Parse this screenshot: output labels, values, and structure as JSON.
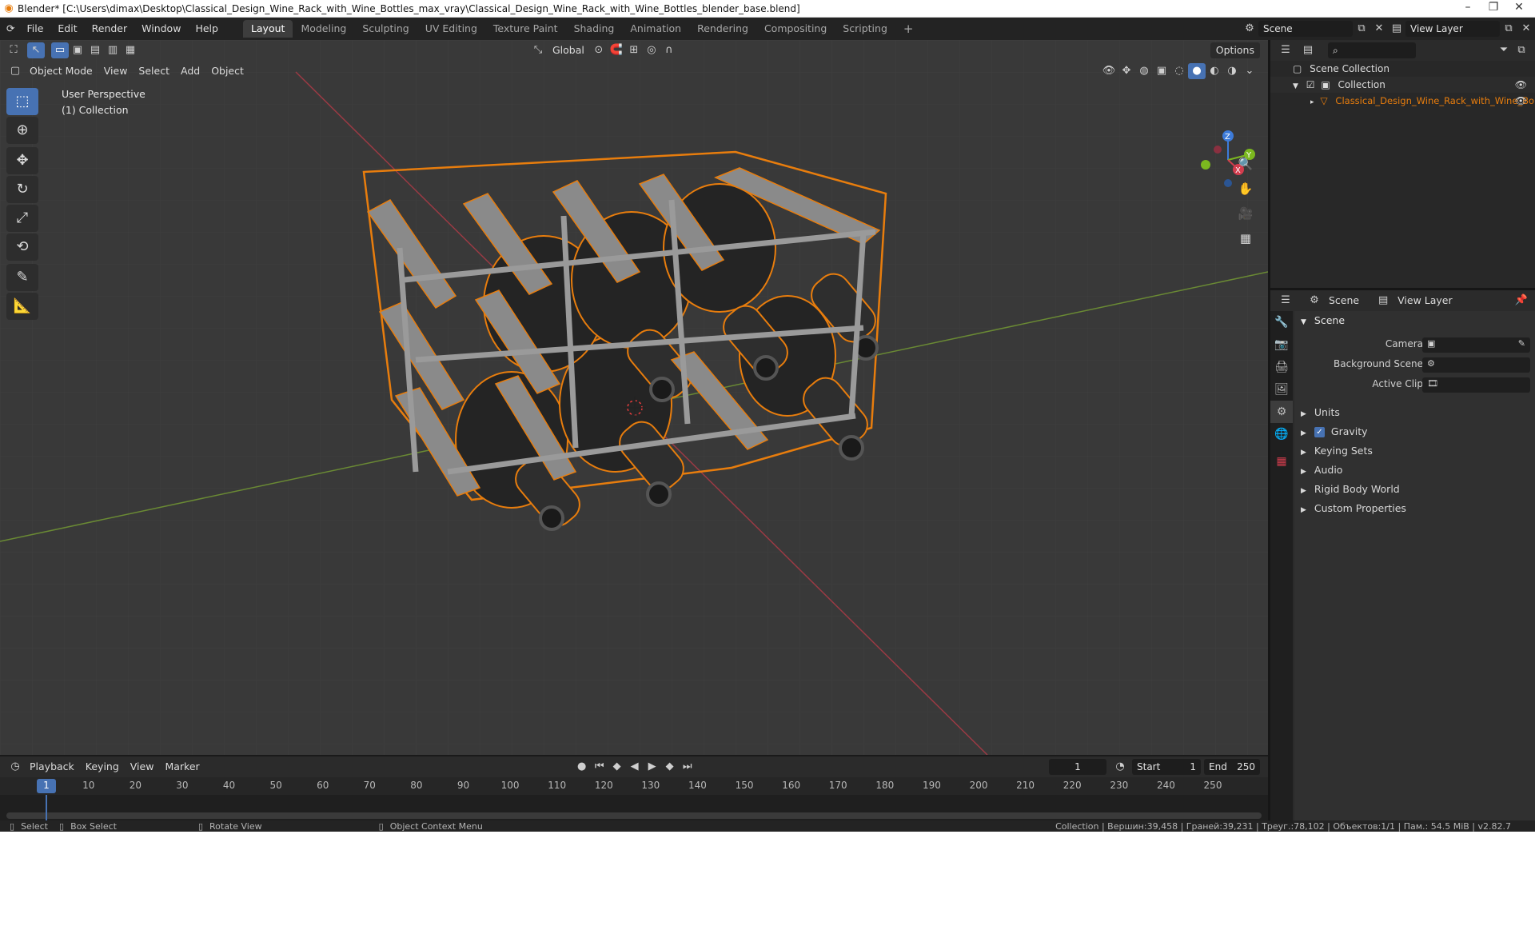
{
  "window": {
    "title": "Blender* [C:\\Users\\dimax\\Desktop\\Classical_Design_Wine_Rack_with_Wine_Bottles_max_vray\\Classical_Design_Wine_Rack_with_Wine_Bottles_blender_base.blend]"
  },
  "menu": [
    "File",
    "Edit",
    "Render",
    "Window",
    "Help"
  ],
  "workspaces": [
    "Layout",
    "Modeling",
    "Sculpting",
    "UV Editing",
    "Texture Paint",
    "Shading",
    "Animation",
    "Rendering",
    "Compositing",
    "Scripting"
  ],
  "topbar": {
    "scene": "Scene",
    "view_layer": "View Layer"
  },
  "viewport": {
    "mode": "Object Mode",
    "menus": [
      "View",
      "Select",
      "Add",
      "Object"
    ],
    "transform_orientation": "Global",
    "options": "Options",
    "info_line1": "User Perspective",
    "info_line2": "(1) Collection"
  },
  "gizmo": {
    "x": "X",
    "y": "Y",
    "z": "Z"
  },
  "timeline": {
    "menus": [
      "Playback",
      "Keying",
      "View",
      "Marker"
    ],
    "current_frame": "1",
    "start_label": "Start",
    "start": "1",
    "end_label": "End",
    "end": "250",
    "ruler": [
      "1",
      "10",
      "20",
      "30",
      "40",
      "50",
      "60",
      "70",
      "80",
      "90",
      "100",
      "110",
      "120",
      "130",
      "140",
      "150",
      "160",
      "170",
      "180",
      "190",
      "200",
      "210",
      "220",
      "230",
      "240",
      "250"
    ]
  },
  "statusbar": {
    "select": "Select",
    "box_select": "Box Select",
    "rotate_view": "Rotate View",
    "context_menu": "Object Context Menu",
    "stats": "Collection | Вершин:39,458 | Граней:39,231 | Треуг.:78,102 | Объектов:1/1 | Пам.: 54.5 MiB | v2.82.7"
  },
  "outliner": {
    "root": "Scene Collection",
    "collection": "Collection",
    "object": "Classical_Design_Wine_Rack_with_Wine_Bo"
  },
  "properties": {
    "tab_scene": "Scene",
    "tab_view_layer": "View Layer",
    "panel": "Scene",
    "camera_label": "Camera",
    "bg_scene_label": "Background Scene",
    "active_clip_label": "Active Clip",
    "sections": [
      "Units",
      "Gravity",
      "Keying Sets",
      "Audio",
      "Rigid Body World",
      "Custom Properties"
    ],
    "gravity_checked": true
  },
  "colors": {
    "accent": "#4772b3",
    "selection_outline": "#e87d0d",
    "axis_x": "#d33d4e",
    "axis_y": "#7bb81f",
    "axis_z": "#3d7bd9"
  }
}
